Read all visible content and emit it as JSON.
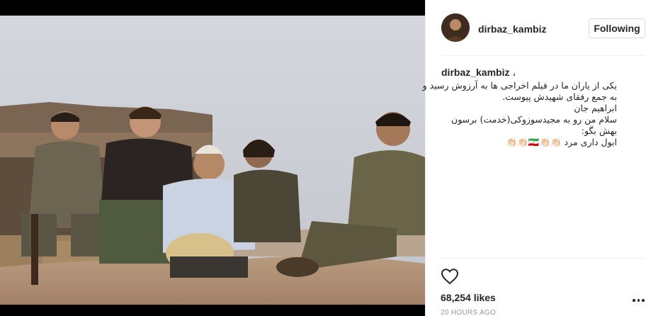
{
  "post": {
    "username": "dirbaz_kambiz",
    "follow_label": "Following",
    "caption_dot": "،",
    "caption_lines": [
      "یکی از یاران ما در فیلم اخراجی ها به آرزوش رسید و",
      "به جمع رفقای شهیدش پیوست.",
      "ابراهیم جان",
      "سلام من رو به مجیدسوزوکی(خدمت) برسون",
      "بهش بگو:",
      "ابول داری مرد 👏🏻👏🏻🇮🇷👏🏻👏🏻"
    ],
    "likes": "68,254 likes",
    "timestamp": "20 HOURS AGO"
  },
  "icons": {
    "heart": "heart-outline-icon",
    "more": "more-options-icon",
    "avatar": "profile-avatar"
  },
  "colors": {
    "text": "#262626",
    "muted": "#999999",
    "border": "#dbdbdb",
    "photo_backdrop": "#000000"
  }
}
